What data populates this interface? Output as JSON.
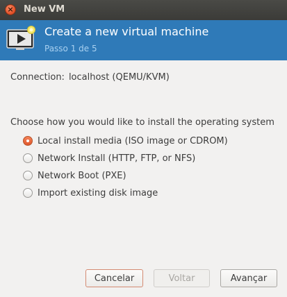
{
  "window": {
    "title": "New VM"
  },
  "banner": {
    "title": "Create a new virtual machine",
    "subtitle": "Passo 1 de 5",
    "icon": "vm-monitor-icon",
    "background_color": "#2f7ab8"
  },
  "connection": {
    "label": "Connection:",
    "value": "localhost (QEMU/KVM)"
  },
  "install": {
    "prompt": "Choose how you would like to install the operating system",
    "options": [
      {
        "label": "Local install media (ISO image or CDROM)",
        "checked": true
      },
      {
        "label": "Network Install (HTTP, FTP, or NFS)",
        "checked": false
      },
      {
        "label": "Network Boot (PXE)",
        "checked": false
      },
      {
        "label": "Import existing disk image",
        "checked": false
      }
    ]
  },
  "buttons": {
    "cancel": "Cancelar",
    "back": "Voltar",
    "next": "Avançar"
  },
  "colors": {
    "accent": "#e0562b",
    "banner": "#2f7ab8",
    "titlebar": "#3c3b37"
  }
}
